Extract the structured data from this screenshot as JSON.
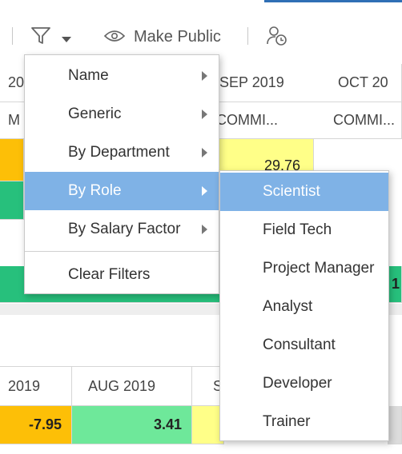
{
  "toolbar": {
    "make_public_label": "Make Public",
    "icons": {
      "filter": "filter-icon",
      "dropdown": "caret-down-icon",
      "eye": "eye-icon",
      "user_clock": "user-clock-icon"
    }
  },
  "grid": {
    "top_headers": [
      "20",
      "SEP 2019",
      "OCT 20"
    ],
    "top_subheaders": [
      "M",
      "COMMI...",
      "COMMI..."
    ],
    "top_value": "29.76",
    "bottom_headers": [
      "2019",
      "AUG 2019",
      "S"
    ],
    "bottom_values": [
      "-7.95",
      "3.41"
    ],
    "bottom_right_partial": "1"
  },
  "filter_menu": {
    "items": [
      {
        "label": "Name",
        "has_submenu": true
      },
      {
        "label": "Generic",
        "has_submenu": true
      },
      {
        "label": "By Department",
        "has_submenu": true
      },
      {
        "label": "By Role",
        "has_submenu": true,
        "active": true
      },
      {
        "label": "By Salary Factor",
        "has_submenu": true
      }
    ],
    "clear_label": "Clear Filters"
  },
  "role_submenu": {
    "items": [
      "Scientist",
      "Field Tech",
      "Project Manager",
      "Analyst",
      "Consultant",
      "Developer",
      "Trainer"
    ],
    "active_index": 0
  },
  "colors": {
    "accent": "#2f6fb5",
    "menu_highlight": "#7fb2e6",
    "orange": "#fdbf07",
    "green": "#27c07c",
    "light_green": "#6ee89a",
    "yellow": "#ffff88"
  }
}
